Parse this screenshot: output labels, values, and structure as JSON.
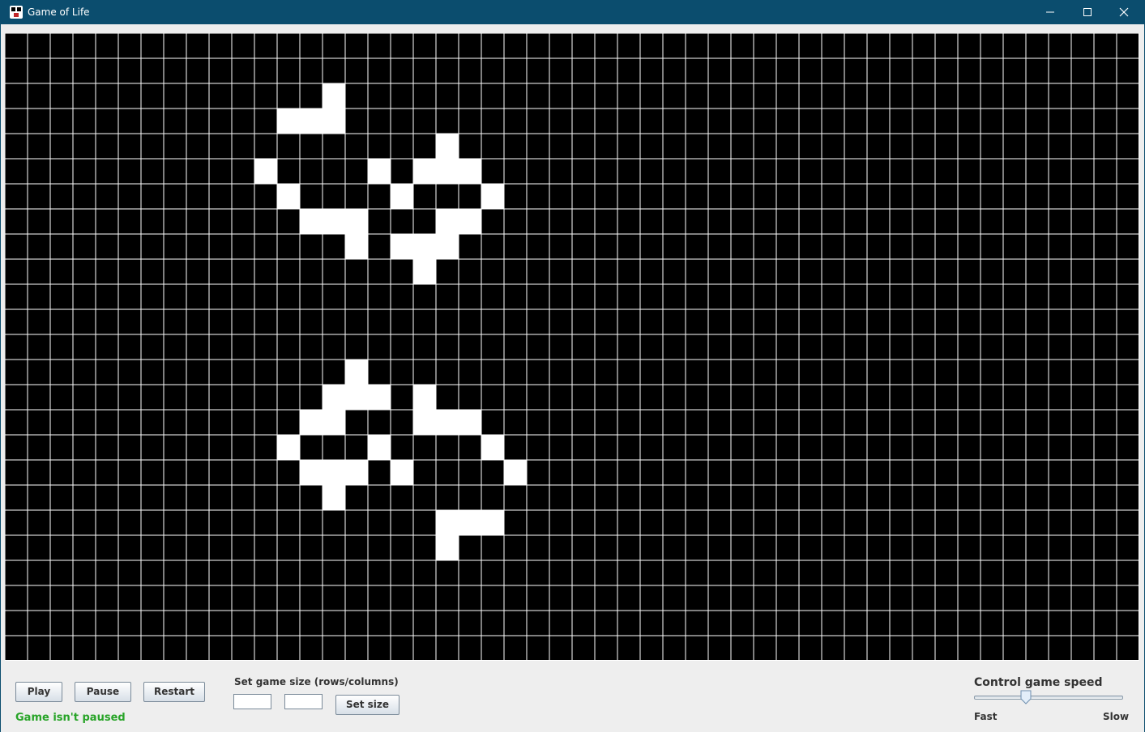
{
  "window": {
    "title": "Game of Life",
    "icon": "game-of-life-icon",
    "controls": [
      "minimize-icon",
      "maximize-icon",
      "close-icon"
    ]
  },
  "board": {
    "rows": 25,
    "columns": 50,
    "cell_colors": {
      "alive": "#ffffff",
      "dead": "#000000",
      "grid": "#ffffff"
    },
    "alive_cells": [
      [
        2,
        14
      ],
      [
        3,
        12
      ],
      [
        3,
        13
      ],
      [
        3,
        14
      ],
      [
        4,
        19
      ],
      [
        5,
        11
      ],
      [
        5,
        16
      ],
      [
        5,
        18
      ],
      [
        5,
        19
      ],
      [
        5,
        20
      ],
      [
        6,
        12
      ],
      [
        6,
        17
      ],
      [
        6,
        21
      ],
      [
        7,
        13
      ],
      [
        7,
        14
      ],
      [
        7,
        15
      ],
      [
        7,
        19
      ],
      [
        7,
        20
      ],
      [
        8,
        15
      ],
      [
        8,
        17
      ],
      [
        8,
        18
      ],
      [
        8,
        19
      ],
      [
        9,
        18
      ],
      [
        13,
        15
      ],
      [
        14,
        14
      ],
      [
        14,
        15
      ],
      [
        14,
        16
      ],
      [
        14,
        18
      ],
      [
        15,
        13
      ],
      [
        15,
        14
      ],
      [
        15,
        18
      ],
      [
        15,
        19
      ],
      [
        15,
        20
      ],
      [
        16,
        12
      ],
      [
        16,
        16
      ],
      [
        16,
        21
      ],
      [
        17,
        13
      ],
      [
        17,
        14
      ],
      [
        17,
        15
      ],
      [
        17,
        17
      ],
      [
        17,
        22
      ],
      [
        18,
        14
      ],
      [
        19,
        19
      ],
      [
        19,
        20
      ],
      [
        19,
        21
      ],
      [
        20,
        19
      ]
    ]
  },
  "controls": {
    "play_label": "Play",
    "pause_label": "Pause",
    "restart_label": "Restart",
    "status_text": "Game isn't paused",
    "status_color": "#28a428",
    "size_label": "Set game size (rows/columns)",
    "rows_value": "",
    "columns_value": "",
    "set_size_label": "Set size",
    "speed_title": "Control game speed",
    "speed_fast_label": "Fast",
    "speed_slow_label": "Slow",
    "speed_level": 0.35
  }
}
